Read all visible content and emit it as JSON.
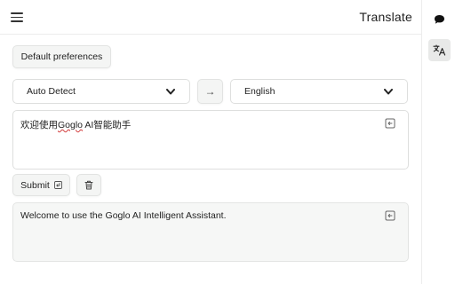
{
  "header": {
    "title": "Translate"
  },
  "toolbar": {
    "preferences_label": "Default preferences",
    "swap_label": "→"
  },
  "languages": {
    "source": "Auto Detect",
    "target": "English"
  },
  "input": {
    "prefix": "欢迎使用",
    "misspelled": "Goglo",
    "suffix": " AI智能助手"
  },
  "actions": {
    "submit_label": "Submit"
  },
  "output": {
    "text": "Welcome to use the Goglo AI Intelligent Assistant."
  },
  "rail": {
    "active": "translate",
    "items": [
      "chat-bubble-icon",
      "translate-icon"
    ]
  },
  "icons": {
    "menu": "hamburger-icon",
    "dropdown": "chevron-down-icon",
    "copy": "copy-icon",
    "submit": "enter-icon",
    "delete": "trash-icon"
  },
  "colors": {
    "rail_active_bg": "#e8e9e8",
    "result_bg": "#f6f7f6",
    "spellcheck": "#d23b3b"
  }
}
